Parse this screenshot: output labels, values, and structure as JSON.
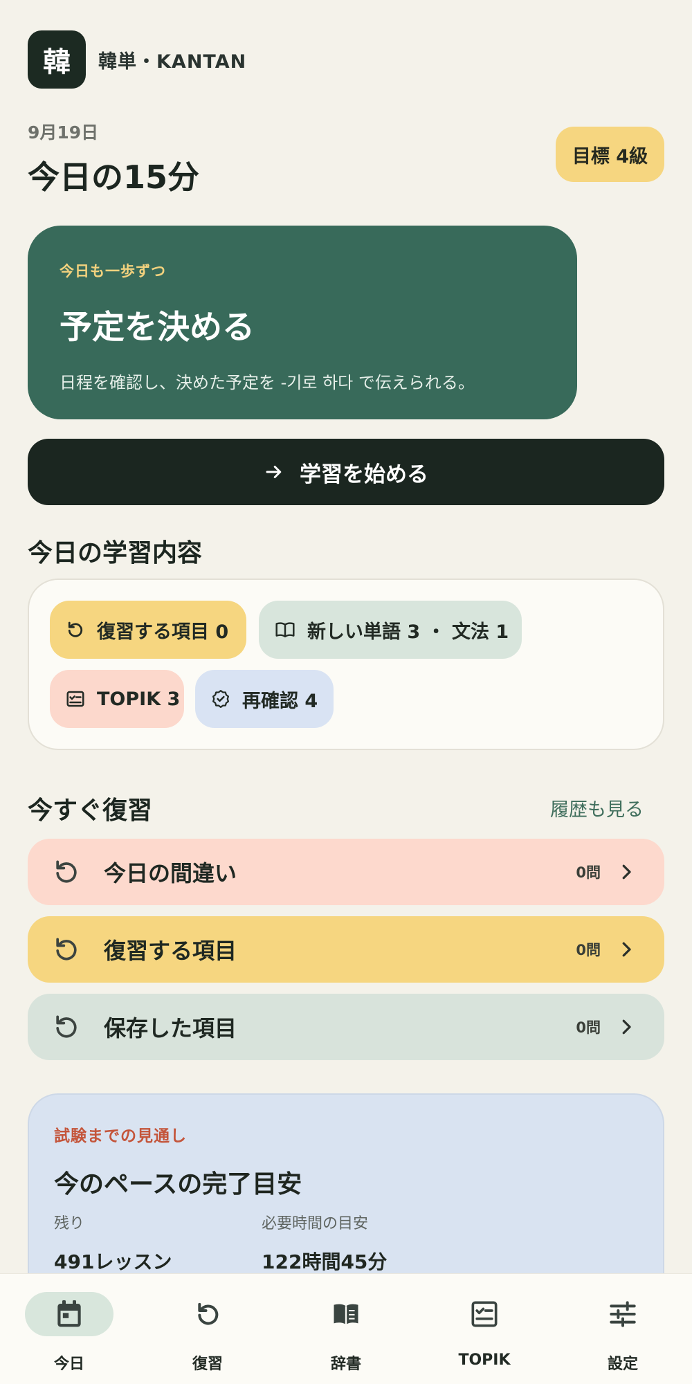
{
  "brand": {
    "logo_char": "韓",
    "name": "韓単・KANTAN"
  },
  "header": {
    "date": "9月19日",
    "title": "今日の15分",
    "goal_badge": "目標 4級"
  },
  "hero": {
    "kicker": "今日も一歩ずつ",
    "title": "予定を決める",
    "description": "日程を確認し、決めた予定を -기로 하다 で伝えられる。"
  },
  "start_button": {
    "label": "学習を始める",
    "icon": "arrow-right-icon"
  },
  "today_content": {
    "title": "今日の学習内容",
    "chips": [
      {
        "label": "復習する項目 0",
        "icon": "refresh-icon",
        "bg": "#f6d680"
      },
      {
        "label": "新しい単語 3 ・ 文法 1",
        "icon": "open-book-icon",
        "bg": "#d8e5dc"
      },
      {
        "label": "TOPIK 3",
        "icon": "checklist-icon",
        "bg": "#fcd8cc"
      },
      {
        "label": "再確認 4",
        "icon": "verified-badge-icon",
        "bg": "#d9e3f3"
      }
    ]
  },
  "review_now": {
    "title": "今すぐ復習",
    "history_link": "履歴も見る",
    "rows": [
      {
        "label": "今日の間違い",
        "count": "0問",
        "bg": "#fdd9cd"
      },
      {
        "label": "復習する項目",
        "count": "0問",
        "bg": "#f6d680"
      },
      {
        "label": "保存した項目",
        "count": "0問",
        "bg": "#d8e3db"
      }
    ]
  },
  "forecast": {
    "kicker": "試験までの見通し",
    "title": "今のペースの完了目安",
    "stats": [
      {
        "label": "残り",
        "value": "491レッスン"
      },
      {
        "label": "必要時間の目安",
        "value": "122時間45分"
      }
    ]
  },
  "bottom_nav": {
    "items": [
      {
        "label": "今日",
        "icon": "calendar-icon",
        "active": true
      },
      {
        "label": "復習",
        "icon": "refresh-icon",
        "active": false
      },
      {
        "label": "辞書",
        "icon": "book-icon",
        "active": false
      },
      {
        "label": "TOPIK",
        "icon": "checklist-icon",
        "active": false
      },
      {
        "label": "設定",
        "icon": "sliders-icon",
        "active": false
      }
    ]
  },
  "colors": {
    "background": "#f4f2ea",
    "hero": "#386a5a",
    "primary_button": "#1b2620",
    "accent_yellow": "#f6d680",
    "forecast_bg": "#d9e3f1",
    "forecast_kicker": "#c4553b"
  }
}
